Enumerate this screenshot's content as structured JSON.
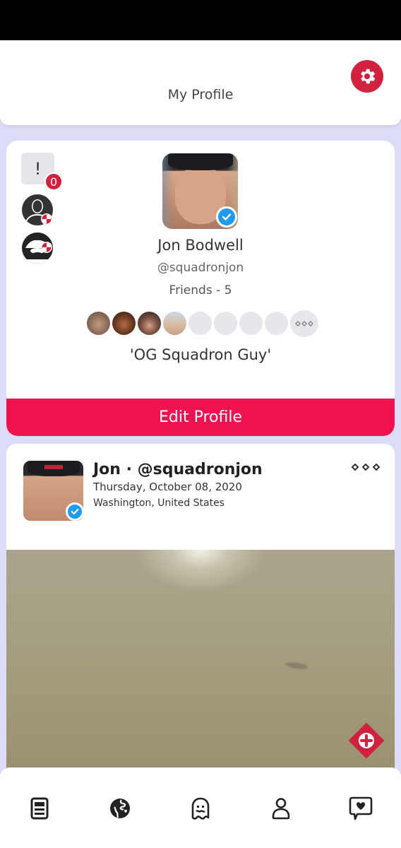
{
  "header": {
    "title": "My Profile",
    "settings_icon": "gear-icon",
    "accent_color": "#d1213f"
  },
  "profile": {
    "alert_icon_glyph": "!",
    "alert_count": "0",
    "name": "Jon Bodwell",
    "handle": "@squadronjon",
    "friends_label": "Friends - 5",
    "friends_more_icon": "ellipsis-diamonds-icon",
    "friend_avatars": [
      {
        "type": "photo"
      },
      {
        "type": "photo"
      },
      {
        "type": "photo"
      },
      {
        "type": "photo"
      },
      {
        "type": "empty"
      },
      {
        "type": "empty"
      },
      {
        "type": "empty"
      },
      {
        "type": "empty"
      }
    ],
    "bio": "'OG Squadron Guy'",
    "edit_button_label": "Edit Profile",
    "edit_button_color": "#ef1150"
  },
  "post": {
    "author_line": "Jon · @squadronjon",
    "date": "Thursday, October 08, 2020",
    "location": "Washington, United States",
    "more_icon": "ellipsis-diamonds-icon"
  },
  "bottom_nav": {
    "items": [
      {
        "name": "feed",
        "icon": "news-feed-icon"
      },
      {
        "name": "explore",
        "icon": "globe-icon"
      },
      {
        "name": "anonymous",
        "icon": "ghost-icon"
      },
      {
        "name": "profile",
        "icon": "user-icon"
      },
      {
        "name": "messages",
        "icon": "heart-chat-icon"
      }
    ]
  }
}
